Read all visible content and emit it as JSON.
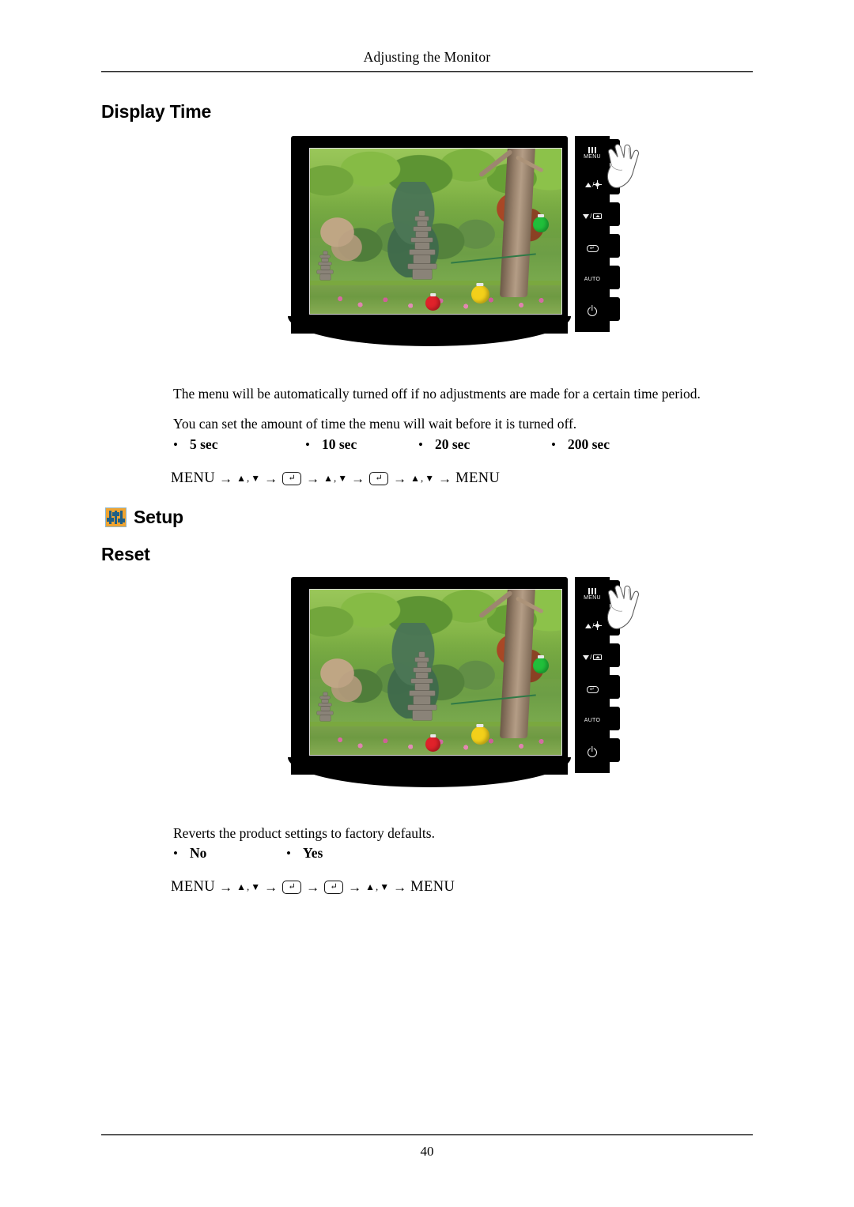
{
  "header": {
    "running_title": "Adjusting the Monitor"
  },
  "footer": {
    "page_number": "40"
  },
  "sections": [
    {
      "heading": "Display Time",
      "paragraphs": [
        "The menu will be automatically turned off if no adjustments are made for a certain time period.",
        "You can set the amount of time the menu will wait before it is turned off."
      ],
      "options": [
        "5 sec",
        "10 sec",
        "20 sec",
        "200 sec"
      ],
      "sequence": {
        "start": "MENU",
        "end": "MENU",
        "steps": [
          "up-down",
          "enter",
          "up-down",
          "enter",
          "up-down"
        ]
      }
    },
    {
      "group_heading": "Setup",
      "group_icon": "setup-sliders-icon",
      "heading": "Reset",
      "paragraphs": [
        "Reverts the product settings to factory defaults."
      ],
      "options": [
        "No",
        "Yes"
      ],
      "sequence": {
        "start": "MENU",
        "end": "MENU",
        "steps": [
          "up-down",
          "enter",
          "enter",
          "up-down"
        ]
      }
    }
  ],
  "symbols": {
    "arrow": "→",
    "bullet": "•",
    "triangle_up": "▲",
    "triangle_down": "▼",
    "comma": ",",
    "enter_key": "↵"
  },
  "monitor_illustration": {
    "screen_content": "Korean temple garden with stone pagodas, colored paper lanterns and flowering shrubs",
    "control_panel_buttons": [
      {
        "name": "menu-button",
        "label": "MENU",
        "icon": "menu-bars-icon"
      },
      {
        "name": "up-brightness-button",
        "label": "",
        "icon": "triangle-up-sun-icon"
      },
      {
        "name": "down-magicbright-button",
        "label": "",
        "icon": "triangle-down-panel-icon"
      },
      {
        "name": "enter-button",
        "label": "",
        "icon": "enter-key-icon"
      },
      {
        "name": "auto-button",
        "label": "AUTO",
        "icon": ""
      },
      {
        "name": "power-button",
        "label": "",
        "icon": "power-icon"
      }
    ],
    "hand_pointer": "hand-pressing-menu"
  },
  "colors": {
    "setup_icon_background": "#f0a430",
    "setup_icon_slider": "#1f5f86",
    "bezel": "#000000",
    "rule": "#2b2b2b"
  }
}
